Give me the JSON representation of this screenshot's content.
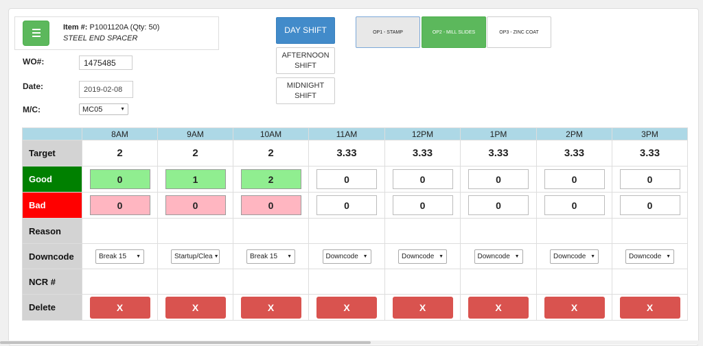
{
  "item": {
    "label": "Item #:",
    "number": "P1001120A (Qty: 50)",
    "description": "STEEL END SPACER"
  },
  "form": {
    "wo_label": "WO#:",
    "wo_value": "1475485",
    "date_label": "Date:",
    "date_value": "2019-02-08",
    "mc_label": "M/C:",
    "mc_value": "MC05"
  },
  "shifts": {
    "day": "DAY SHIFT",
    "afternoon_1": "AFTERNOON",
    "afternoon_2": "SHIFT",
    "midnight_1": "MIDNIGHT",
    "midnight_2": "SHIFT"
  },
  "operations": {
    "op1": "OP1 - STAMP",
    "op2": "OP2 - MILL SLIDES",
    "op3": "OP3 - ZINC COAT"
  },
  "table": {
    "row_labels": {
      "target": "Target",
      "good": "Good",
      "bad": "Bad",
      "reason": "Reason",
      "downcode": "Downcode",
      "ncr": "NCR #",
      "delete": "Delete"
    },
    "hours": [
      "8AM",
      "9AM",
      "10AM",
      "11AM",
      "12PM",
      "1PM",
      "2PM",
      "3PM"
    ],
    "target": [
      "2",
      "2",
      "2",
      "3.33",
      "3.33",
      "3.33",
      "3.33",
      "3.33"
    ],
    "good": [
      "0",
      "1",
      "2",
      "0",
      "0",
      "0",
      "0",
      "0"
    ],
    "bad": [
      "0",
      "0",
      "0",
      "0",
      "0",
      "0",
      "0",
      "0"
    ],
    "downcode": [
      "Break 15",
      "Startup/Clea",
      "Break 15",
      "Downcode",
      "Downcode",
      "Downcode",
      "Downcode",
      "Downcode"
    ],
    "delete_label": "X"
  },
  "colors": {
    "good_row": "#008000",
    "bad_row": "#ff0000",
    "header": "#add8e6",
    "good_filled": "#90ee90",
    "bad_filled": "#ffb6c1",
    "delete_button": "#d9534f",
    "day_shift_active": "#428bca",
    "op_active": "#5cb85c"
  }
}
